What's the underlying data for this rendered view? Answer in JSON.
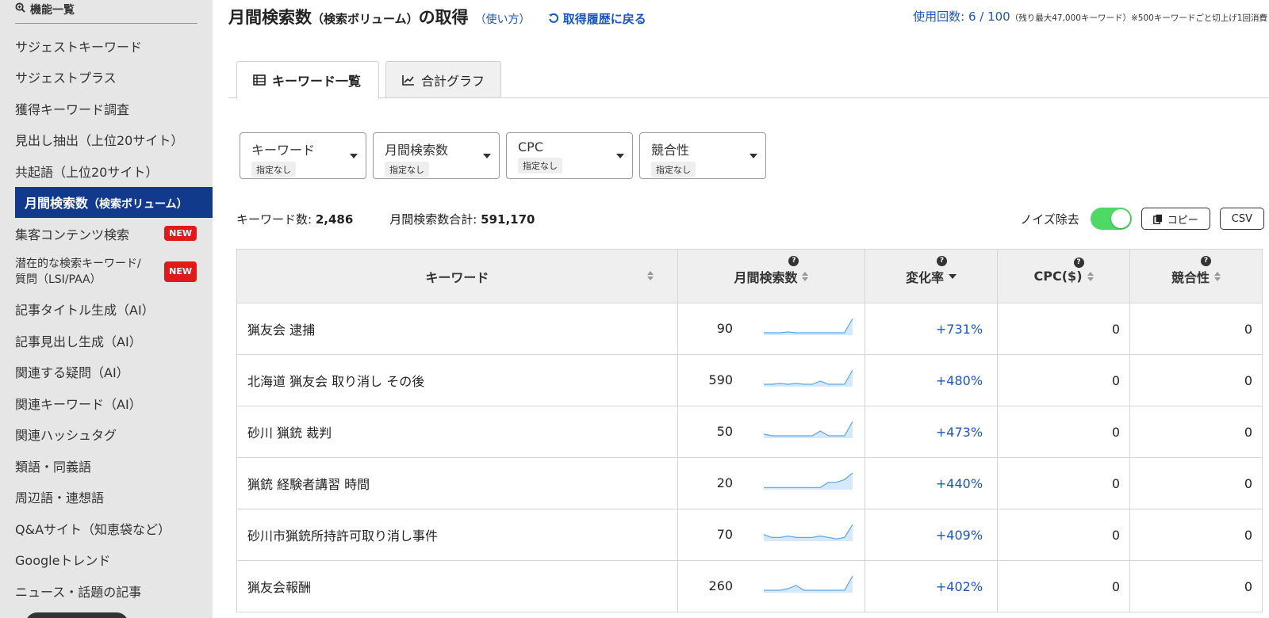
{
  "sidebar": {
    "header": "機能一覧",
    "items": [
      {
        "label": "サジェストキーワード"
      },
      {
        "label": "サジェストプラス"
      },
      {
        "label": "獲得キーワード調査"
      },
      {
        "label": "見出し抽出（上位20サイト）"
      },
      {
        "label": "共起語（上位20サイト）"
      },
      {
        "label": "月間検索数",
        "sub": "（検索ボリューム）"
      },
      {
        "label": "集客コンテンツ検索",
        "badge": "NEW"
      },
      {
        "label": "潜在的な検索キーワード/",
        "label2": "質問（LSI/PAA）",
        "badge": "NEW"
      },
      {
        "label": "記事タイトル生成（AI）"
      },
      {
        "label": "記事見出し生成（AI）"
      },
      {
        "label": "関連する疑問（AI）"
      },
      {
        "label": "関連キーワード（AI）"
      },
      {
        "label": "関連ハッシュタグ"
      },
      {
        "label": "類語・同義語"
      },
      {
        "label": "周辺語・連想語"
      },
      {
        "label": "Q&Aサイト（知恵袋など）"
      },
      {
        "label": "Googleトレンド"
      },
      {
        "label": "ニュース・話題の記事"
      }
    ]
  },
  "header": {
    "title": "月間検索数",
    "title_paren": "（検索ボリューム）",
    "title_suffix": "の取得",
    "howto": "（使い方）",
    "history": "取得履歴に戻る",
    "usage_label": "使用回数: 6 / 100",
    "usage_note": "（残り最大47,000キーワード）※500キーワードごと切上げ1回消費"
  },
  "tabs": [
    {
      "label": "キーワード一覧"
    },
    {
      "label": "合計グラフ"
    }
  ],
  "filters": [
    {
      "label": "キーワード",
      "value": "指定なし"
    },
    {
      "label": "月間検索数",
      "value": "指定なし"
    },
    {
      "label": "CPC",
      "value": "指定なし"
    },
    {
      "label": "競合性",
      "value": "指定なし"
    }
  ],
  "stats": {
    "kw_count_label": "キーワード数:",
    "kw_count": "2,486",
    "vol_total_label": "月間検索数合計:",
    "vol_total": "591,170"
  },
  "tools": {
    "noise_label": "ノイズ除去",
    "noise_on": true,
    "copy_label": "コピー",
    "csv_label": "CSV"
  },
  "table": {
    "columns": [
      "キーワード",
      "月間検索数",
      "変化率",
      "CPC($)",
      "競合性"
    ],
    "rows": [
      {
        "keyword": "猟友会 逮捕",
        "volume": "90",
        "change": "+731%",
        "cpc": "0",
        "comp": "0",
        "trend": [
          1,
          1,
          1,
          1.5,
          1,
          1,
          1,
          1,
          1,
          1,
          1,
          10
        ]
      },
      {
        "keyword": "北海道 猟友会 取り消し その後",
        "volume": "590",
        "change": "+480%",
        "cpc": "0",
        "comp": "0",
        "trend": [
          1,
          1,
          1.5,
          1,
          1.5,
          1,
          1,
          3,
          1,
          1,
          1,
          10
        ]
      },
      {
        "keyword": "砂川 猟銃 裁判",
        "volume": "50",
        "change": "+473%",
        "cpc": "0",
        "comp": "0",
        "trend": [
          2,
          1,
          1,
          1,
          1,
          1,
          1,
          4,
          1,
          1,
          1,
          10
        ]
      },
      {
        "keyword": "猟銃 経験者講習 時間",
        "volume": "20",
        "change": "+440%",
        "cpc": "0",
        "comp": "0",
        "trend": [
          1,
          1,
          1,
          1,
          1,
          1,
          1,
          1,
          5,
          5,
          7,
          12
        ]
      },
      {
        "keyword": "砂川市猟銃所持許可取り消し事件",
        "volume": "70",
        "change": "+409%",
        "cpc": "0",
        "comp": "0",
        "trend": [
          4,
          2,
          2,
          3,
          2,
          2,
          2,
          3,
          2,
          1,
          2,
          11
        ]
      },
      {
        "keyword": "猟友会報酬",
        "volume": "260",
        "change": "+402%",
        "cpc": "0",
        "comp": "0",
        "trend": [
          1,
          1,
          1,
          2,
          4,
          1,
          1,
          1,
          1,
          1,
          1,
          10
        ]
      }
    ]
  },
  "colors": {
    "accent": "#123a8c",
    "link": "#1a55c8",
    "toggle_on": "#4cd964",
    "badge_new": "#e01919",
    "spark_line": "#5aa7e8",
    "spark_fill": "#d6e9fa"
  }
}
